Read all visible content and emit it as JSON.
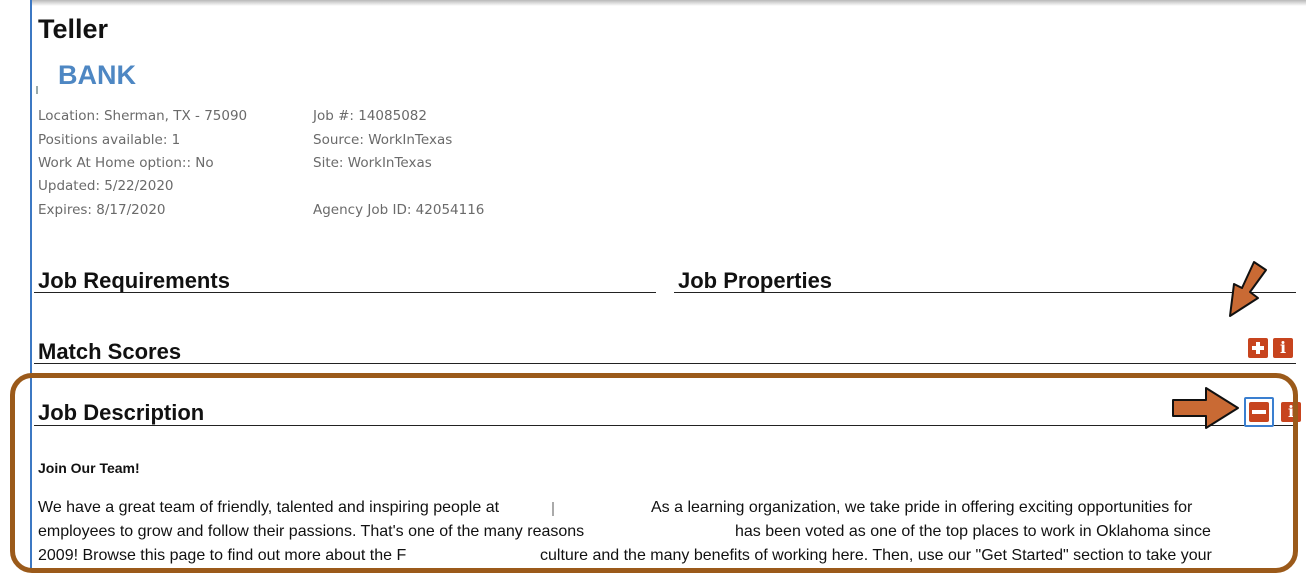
{
  "job": {
    "title": "Teller",
    "company": "BANK",
    "location": "Location: Sherman, TX - 75090",
    "positions": "Positions available: 1",
    "work_at_home": "Work At Home option:: No",
    "updated": "Updated: 5/22/2020",
    "expires": "Expires: 8/17/2020",
    "job_number": "Job #: 14085082",
    "source": "Source: WorkInTexas",
    "site": "Site: WorkInTexas",
    "agency_id": "Agency Job ID: 42054116"
  },
  "sections": {
    "requirements": "Job Requirements",
    "properties": "Job Properties",
    "match_scores": "Match Scores",
    "description": "Job Description"
  },
  "description": {
    "heading": "Join Our Team!",
    "line1_a": "We have a great team of friendly, talented and inspiring people at",
    "line1_b": "As a learning organization, we take pride in offering exciting opportunities for",
    "line2_a": "employees to grow and follow their passions. That's one of the many reasons",
    "line2_b": "has been voted as one of the top places to work in Oklahoma since",
    "line3_a": "2009! Browse this page to find out more about the F",
    "line3_b": "culture and the many benefits of working here. Then, use our \"Get Started\" section to take your"
  },
  "icons": {
    "expand": "plus-icon",
    "collapse": "minus-icon",
    "info": "info-icon",
    "info_glyph": "i"
  },
  "colors": {
    "accent": "#c7441e",
    "brand": "#4e87c3",
    "highlight": "#9b5a1a"
  }
}
